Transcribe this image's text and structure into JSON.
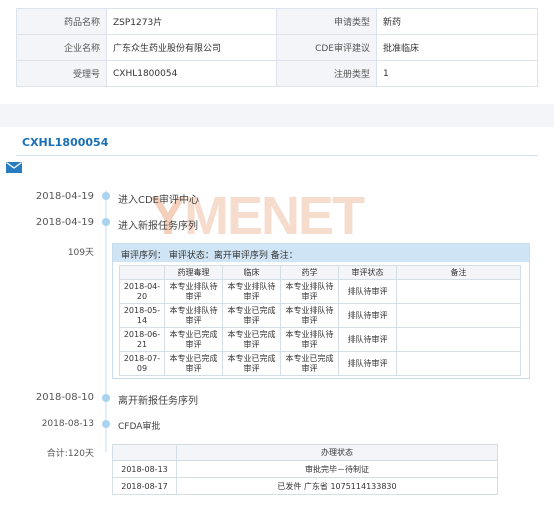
{
  "info": {
    "rows": [
      {
        "k1": "药品名称",
        "v1": "ZSP1273片",
        "k2": "申请类型",
        "v2": "新药"
      },
      {
        "k1": "企业名称",
        "v1": "广东众生药业股份有限公司",
        "k2": "CDE审评建议",
        "v2": "批准临床"
      },
      {
        "k1": "受理号",
        "v1": "CXHL1800054",
        "k2": "注册类型",
        "v2": "1"
      }
    ]
  },
  "accept_no": "CXHL1800054",
  "watermark": {
    "prefix": "Y",
    "main": "MENET"
  },
  "timeline": {
    "e1": {
      "date": "2018-04-19",
      "text": "进入CDE审评中心"
    },
    "e2": {
      "date": "2018-04-19",
      "text": "进入新报任务序列"
    },
    "duration": "109天",
    "e3": {
      "date": "2018-08-10",
      "text": "离开新报任务序列"
    },
    "e4": {
      "date": "2018-08-13",
      "text": "CFDA审批"
    },
    "total": "合计:120天"
  },
  "queue": {
    "header": "审评序列：   审评状态：离开审评序列   备注：",
    "columns": [
      "",
      "药理毒理",
      "临床",
      "药学",
      "审评状态",
      "备注"
    ],
    "rows": [
      {
        "date": "2018-04-20",
        "c1": "本专业排队待审评",
        "c2": "本专业排队待审评",
        "c3": "本专业排队待审评",
        "status": "排队待审评",
        "note": ""
      },
      {
        "date": "2018-05-14",
        "c1": "本专业排队待审评",
        "c2": "本专业已完成审评",
        "c3": "本专业排队待审评",
        "status": "排队待审评",
        "note": ""
      },
      {
        "date": "2018-06-21",
        "c1": "本专业已完成审评",
        "c2": "本专业已完成审评",
        "c3": "本专业排队待审评",
        "status": "排队待审评",
        "note": ""
      },
      {
        "date": "2018-07-09",
        "c1": "本专业已完成审评",
        "c2": "本专业已完成审评",
        "c3": "本专业已完成审评",
        "status": "排队待审评",
        "note": ""
      }
    ]
  },
  "status_table": {
    "columns": [
      "",
      "办理状态"
    ],
    "rows": [
      {
        "date": "2018-08-13",
        "status": "审批完毕－待制证"
      },
      {
        "date": "2018-08-17",
        "status": "已发件 广东省 1075114133830"
      }
    ]
  },
  "colors": {
    "accent": "#1a6fb5",
    "header_bg": "#cfe5f5",
    "key_bg": "#f3f5f8",
    "timeline_dot": "#a9d3ef"
  },
  "icons": [
    "mail-icon"
  ]
}
